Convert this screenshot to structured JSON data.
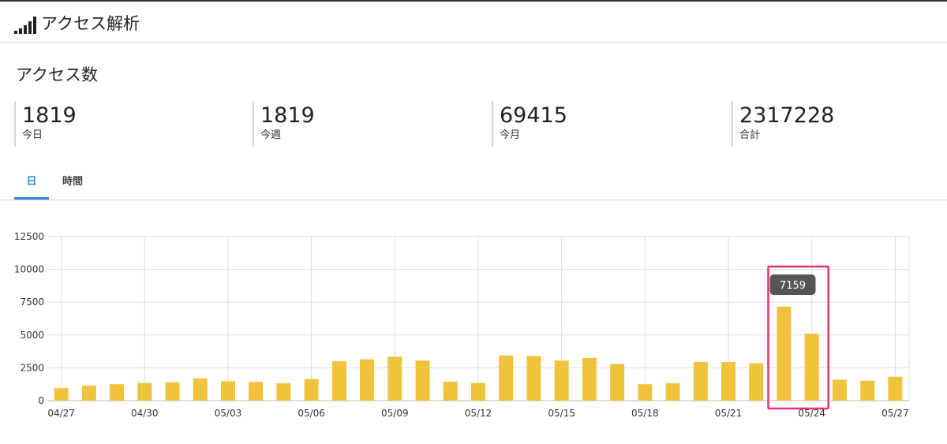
{
  "header": {
    "title": "アクセス解析",
    "icon": "signal-bars-icon"
  },
  "section": {
    "title": "アクセス数"
  },
  "stats": [
    {
      "value": "1819",
      "label": "今日"
    },
    {
      "value": "1819",
      "label": "今週"
    },
    {
      "value": "69415",
      "label": "今月"
    },
    {
      "value": "2317228",
      "label": "合計"
    }
  ],
  "tabs": [
    {
      "label": "日",
      "active": true
    },
    {
      "label": "時間",
      "active": false
    }
  ],
  "colors": {
    "bar": "#f0c33c",
    "accent": "#2c8bd6",
    "highlight": "#e8336e",
    "tooltip": "#555555"
  },
  "chart_data": {
    "type": "bar",
    "categories": [
      "04/27",
      "04/28",
      "04/29",
      "04/30",
      "05/01",
      "05/02",
      "05/03",
      "05/04",
      "05/05",
      "05/06",
      "05/07",
      "05/08",
      "05/09",
      "05/10",
      "05/11",
      "05/12",
      "05/13",
      "05/14",
      "05/15",
      "05/16",
      "05/17",
      "05/18",
      "05/19",
      "05/20",
      "05/21",
      "05/22",
      "05/23",
      "05/24",
      "05/25",
      "05/26",
      "05/27"
    ],
    "values": [
      950,
      1150,
      1250,
      1350,
      1400,
      1700,
      1480,
      1430,
      1320,
      1650,
      3000,
      3150,
      3350,
      3050,
      1450,
      1350,
      3450,
      3400,
      3050,
      3250,
      2800,
      1250,
      1320,
      2950,
      2950,
      2850,
      7159,
      5100,
      1600,
      1520,
      1820
    ],
    "xtick_labels": [
      "04/27",
      "04/30",
      "05/03",
      "05/06",
      "05/09",
      "05/12",
      "05/15",
      "05/18",
      "05/21",
      "05/24",
      "05/27"
    ],
    "yticks": [
      0,
      2500,
      5000,
      7500,
      10000,
      12500
    ],
    "ylim": [
      0,
      12500
    ],
    "grid": true,
    "title": "",
    "xlabel": "",
    "ylabel": "",
    "tooltip": {
      "category": "05/23",
      "value": "7159"
    },
    "highlight_categories": [
      "05/23",
      "05/24"
    ]
  }
}
